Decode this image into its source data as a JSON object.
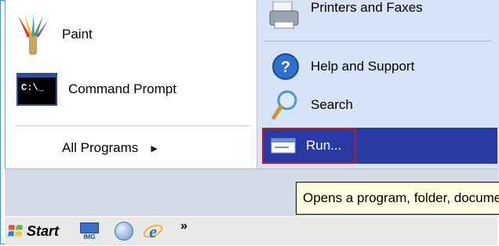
{
  "left_items": [
    {
      "label": "Paint",
      "icon": "paint-icon"
    },
    {
      "label": "Command Prompt",
      "icon": "command-prompt-icon"
    }
  ],
  "cmd_icon_text": "C:\\_",
  "all_programs": {
    "label": "All Programs",
    "arrow": "▶"
  },
  "right_items": [
    {
      "label": "Printers and Faxes",
      "icon": "printer-icon"
    },
    {
      "label": "Help and Support",
      "icon": "help-icon"
    },
    {
      "label": "Search",
      "icon": "search-icon"
    },
    {
      "label": "Run...",
      "icon": "run-icon"
    }
  ],
  "tooltip": "Opens a program, folder, document",
  "taskbar": {
    "start_label": "Start",
    "img_label": "IMG",
    "overflow": "»"
  },
  "colors": {
    "selection": "#2a3aa4",
    "highlight_box": "#c31a1a",
    "tooltip_bg": "#ffffe1"
  }
}
